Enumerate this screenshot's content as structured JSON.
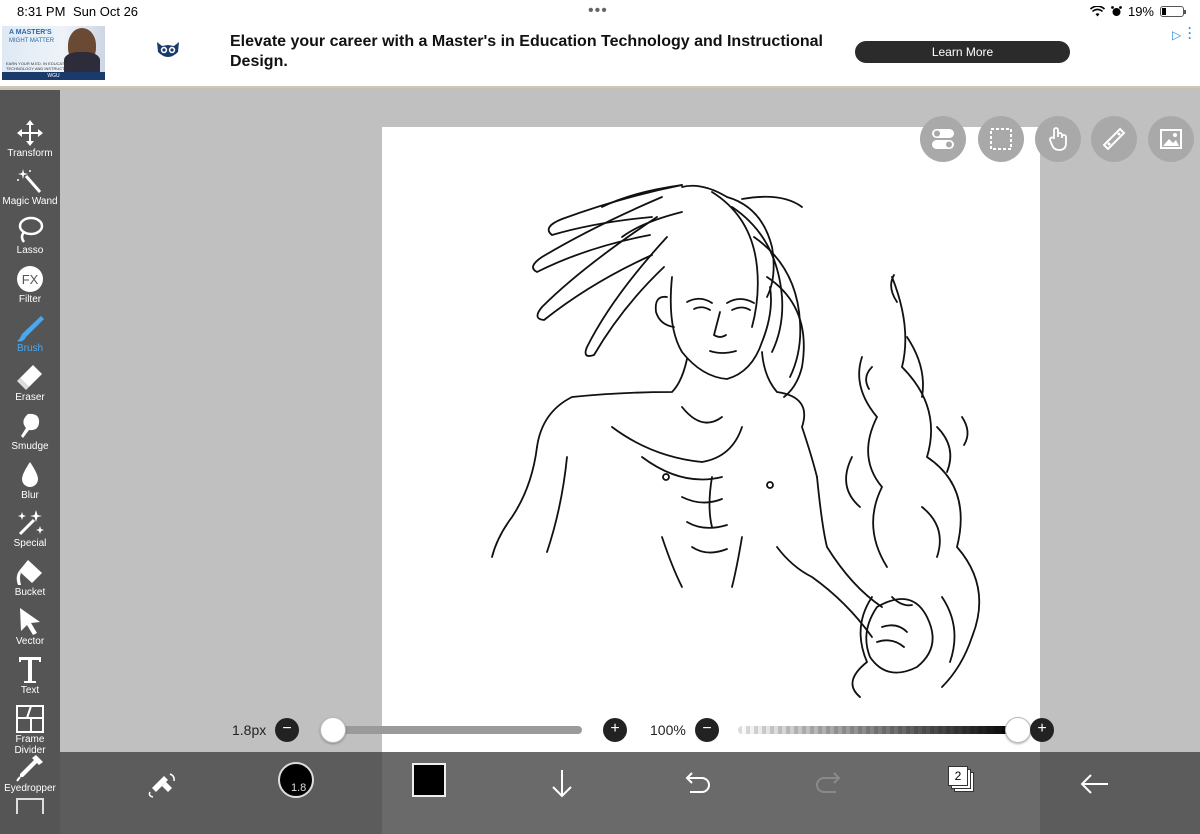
{
  "status_bar": {
    "time": "8:31 PM",
    "date": "Sun Oct 26",
    "dots": "•••",
    "battery": "19%",
    "battery_level": 0.19
  },
  "ad": {
    "thumb_title": "A MASTER'S",
    "thumb_sub": "MIGHT MATTER",
    "thumb_small": "EARN YOUR M.ED. IN EDUCATION TECHNOLOGY AND INSTRUCTIONAL DESIGN",
    "thumb_brand": "WGU",
    "headline": "Elevate your career with a Master's in Education Technology and Instructional Design.",
    "cta_label": "Learn More"
  },
  "tools": [
    {
      "name": "transform",
      "label": "Transform",
      "icon": "move-arrows-icon"
    },
    {
      "name": "magic-wand",
      "label": "Magic Wand",
      "icon": "magic-wand-icon"
    },
    {
      "name": "lasso",
      "label": "Lasso",
      "icon": "lasso-icon"
    },
    {
      "name": "filter",
      "label": "Filter",
      "icon": "fx-icon"
    },
    {
      "name": "brush",
      "label": "Brush",
      "icon": "brush-icon",
      "active": true
    },
    {
      "name": "eraser",
      "label": "Eraser",
      "icon": "eraser-icon"
    },
    {
      "name": "smudge",
      "label": "Smudge",
      "icon": "smudge-icon"
    },
    {
      "name": "blur",
      "label": "Blur",
      "icon": "drop-icon"
    },
    {
      "name": "special",
      "label": "Special",
      "icon": "sparkle-wand-icon"
    },
    {
      "name": "bucket",
      "label": "Bucket",
      "icon": "bucket-icon"
    },
    {
      "name": "vector",
      "label": "Vector",
      "icon": "cursor-arrow-icon"
    },
    {
      "name": "text",
      "label": "Text",
      "icon": "text-t-icon"
    },
    {
      "name": "frame-divider",
      "label": "Frame Divider",
      "icon": "frame-divider-icon"
    },
    {
      "name": "eyedropper",
      "label": "Eyedropper",
      "icon": "eyedropper-icon"
    }
  ],
  "brush": {
    "size_label": "1.8px",
    "size_badge": "1.8",
    "opacity_label": "100%",
    "size_value": 0.05,
    "opacity_value": 1.0
  },
  "layers": {
    "count": "2"
  },
  "colors": {
    "accent": "#4aa8f0",
    "toolbar": "#555555",
    "current_color": "#000000"
  }
}
